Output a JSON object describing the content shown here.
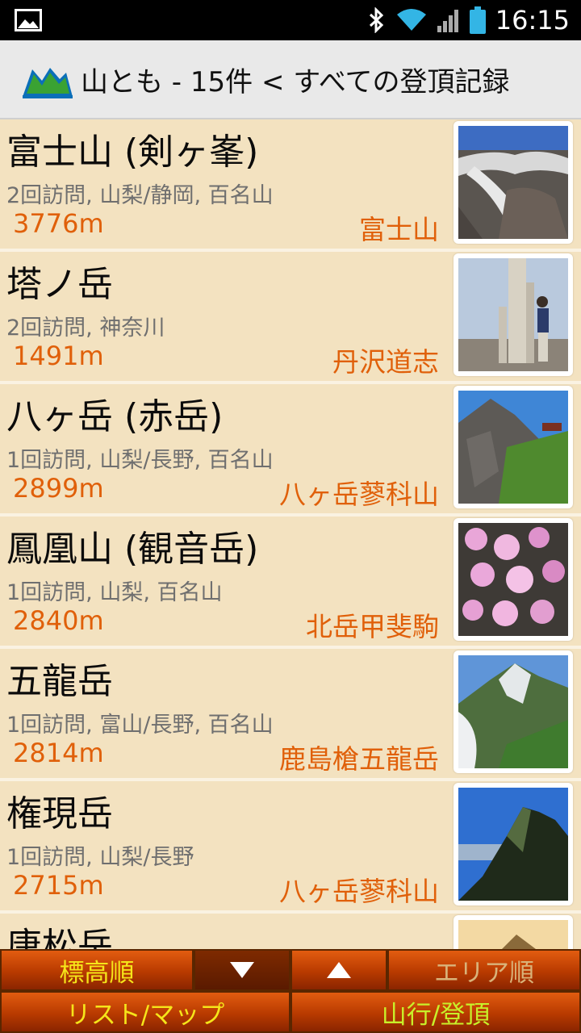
{
  "status_bar": {
    "time": "16:15",
    "icons": [
      "gallery-icon",
      "bluetooth-icon",
      "wifi-icon",
      "signal-icon",
      "battery-icon"
    ]
  },
  "header": {
    "title": "山とも - 15件 < すべての登頂記録",
    "logo_icon": "mountain-logo-icon"
  },
  "list": {
    "items": [
      {
        "name": "富士山 (剣ヶ峯)",
        "info": "2回訪問, 山梨/静岡, 百名山",
        "elevation": "3776m",
        "area": "富士山",
        "photo": "crater-photo"
      },
      {
        "name": "塔ノ岳",
        "info": "2回訪問, 神奈川",
        "elevation": "1491m",
        "area": "丹沢道志",
        "photo": "summit-marker-photo"
      },
      {
        "name": "八ヶ岳 (赤岳)",
        "info": "1回訪問, 山梨/長野, 百名山",
        "elevation": "2899m",
        "area": "八ヶ岳蓼科山",
        "photo": "rocky-peak-photo"
      },
      {
        "name": "鳳凰山 (観音岳)",
        "info": "1回訪問, 山梨, 百名山",
        "elevation": "2840m",
        "area": "北岳甲斐駒",
        "photo": "flowers-photo"
      },
      {
        "name": "五龍岳",
        "info": "1回訪問, 富山/長野, 百名山",
        "elevation": "2814m",
        "area": "鹿島槍五龍岳",
        "photo": "green-ridge-photo"
      },
      {
        "name": "権現岳",
        "info": "1回訪問, 山梨/長野",
        "elevation": "2715m",
        "area": "八ヶ岳蓼科山",
        "photo": "silhouette-peak-photo"
      },
      {
        "name": "唐松岳",
        "info": "",
        "elevation": "",
        "area": "",
        "photo": "sunset-peak-photo"
      }
    ]
  },
  "bottom_bar": {
    "sort_elevation": "標高順",
    "sort_desc_icon": "triangle-down-icon",
    "sort_asc_icon": "triangle-up-icon",
    "sort_area": "エリア順",
    "list_map": "リスト/マップ",
    "climb_record": "山行/登頂"
  },
  "colors": {
    "accent": "#e0600a",
    "list_bg": "#f3e2c0",
    "button": "#c64400",
    "button_text": "#f5e51a"
  }
}
